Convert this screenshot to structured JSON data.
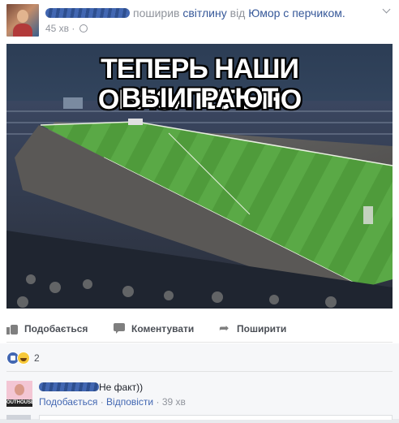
{
  "post": {
    "action_text": "поширив",
    "photo_word": "світлину",
    "from_word": "від",
    "source_page": "Юмор с перчиком.",
    "time": "45 хв",
    "meme_line1": "ТЕПЕРЬ НАШИ ОБЯЗАТЕЛЬНО",
    "meme_line2": "ВЫИГРАЮТ"
  },
  "actions": {
    "like": "Подобається",
    "comment": "Коментувати",
    "share": "Поширити"
  },
  "reactions": {
    "count": "2"
  },
  "comment": {
    "text": "Не факт))",
    "like": "Подобається",
    "separator": "·",
    "reply": "Відповісти",
    "time": "39 хв",
    "avatar_label": "OUTHOUSE"
  },
  "colors": {
    "link": "#365899",
    "grass": "#4e9a3a",
    "meta": "#90949c"
  }
}
